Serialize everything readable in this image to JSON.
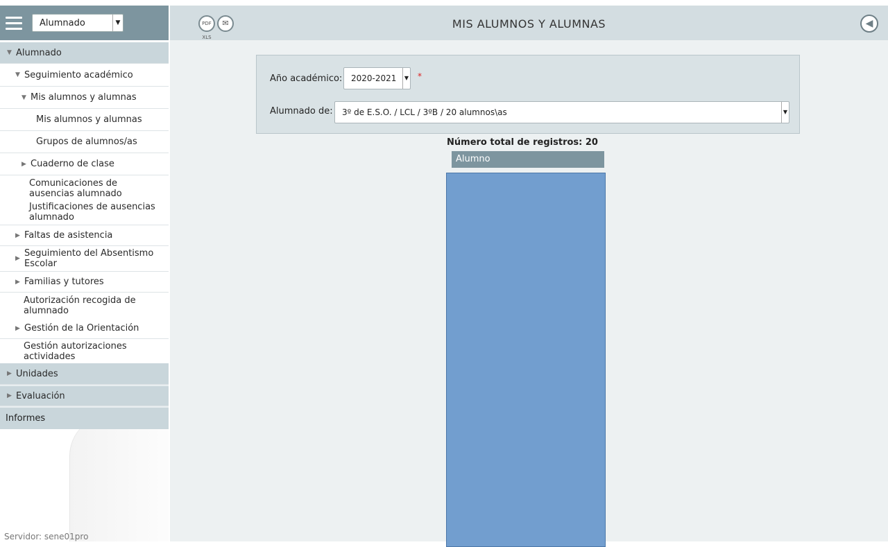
{
  "sidebar": {
    "selector_value": "Alumnado",
    "menu": [
      {
        "label": "Alumnado",
        "level": 0,
        "marker": "▼"
      },
      {
        "label": "Seguimiento académico",
        "level": 1,
        "marker": "▼"
      },
      {
        "label": "Mis alumnos y alumnas",
        "level": 2,
        "marker": "▼"
      },
      {
        "label": "Mis alumnos y alumnas",
        "level": 3,
        "marker": ""
      },
      {
        "label": "Grupos de alumnos/as",
        "level": 3,
        "marker": ""
      },
      {
        "label": "Cuaderno de clase",
        "level": 2,
        "marker": "▶"
      },
      {
        "label": "Comunicaciones de ausencias alumnado",
        "level": 1,
        "marker": ""
      },
      {
        "label": "Justificaciones de ausencias alumnado",
        "level": 1,
        "marker": ""
      },
      {
        "label": "Faltas de asistencia",
        "level": 1,
        "marker": "▶"
      },
      {
        "label": "Seguimiento del Absentismo Escolar",
        "level": 1,
        "marker": "▶"
      },
      {
        "label": "Familias y tutores",
        "level": 1,
        "marker": "▶"
      },
      {
        "label": "Autorización recogida de alumnado",
        "level": 1,
        "marker": ""
      },
      {
        "label": "Gestión de la Orientación",
        "level": 1,
        "marker": "▶"
      },
      {
        "label": "Gestión autorizaciones actividades",
        "level": 1,
        "marker": ""
      },
      {
        "label": "Unidades",
        "level": 0,
        "marker": "▶"
      },
      {
        "label": "Evaluación",
        "level": 0,
        "marker": "▶"
      },
      {
        "label": "Informes",
        "level": 0,
        "marker": ""
      }
    ],
    "server": "Servidor: sene01pro"
  },
  "header": {
    "title": "MIS ALUMNOS Y ALUMNAS",
    "pdf_icon_text": "PDF XLS"
  },
  "filters": {
    "year_label": "Año académico:",
    "year_value": "2020-2021",
    "required_mark": "*",
    "group_label": "Alumnado de:",
    "group_value": "3º de E.S.O. / LCL / 3ºB / 20 alumnos\\as"
  },
  "results": {
    "total_text": "Número total de registros: 20",
    "column_header": "Alumno"
  },
  "colors": {
    "sidebar_header": "#7d959f",
    "menu_section": "#c9d6db",
    "main_bg": "#edf1f2",
    "list_fill": "#729ecf"
  }
}
